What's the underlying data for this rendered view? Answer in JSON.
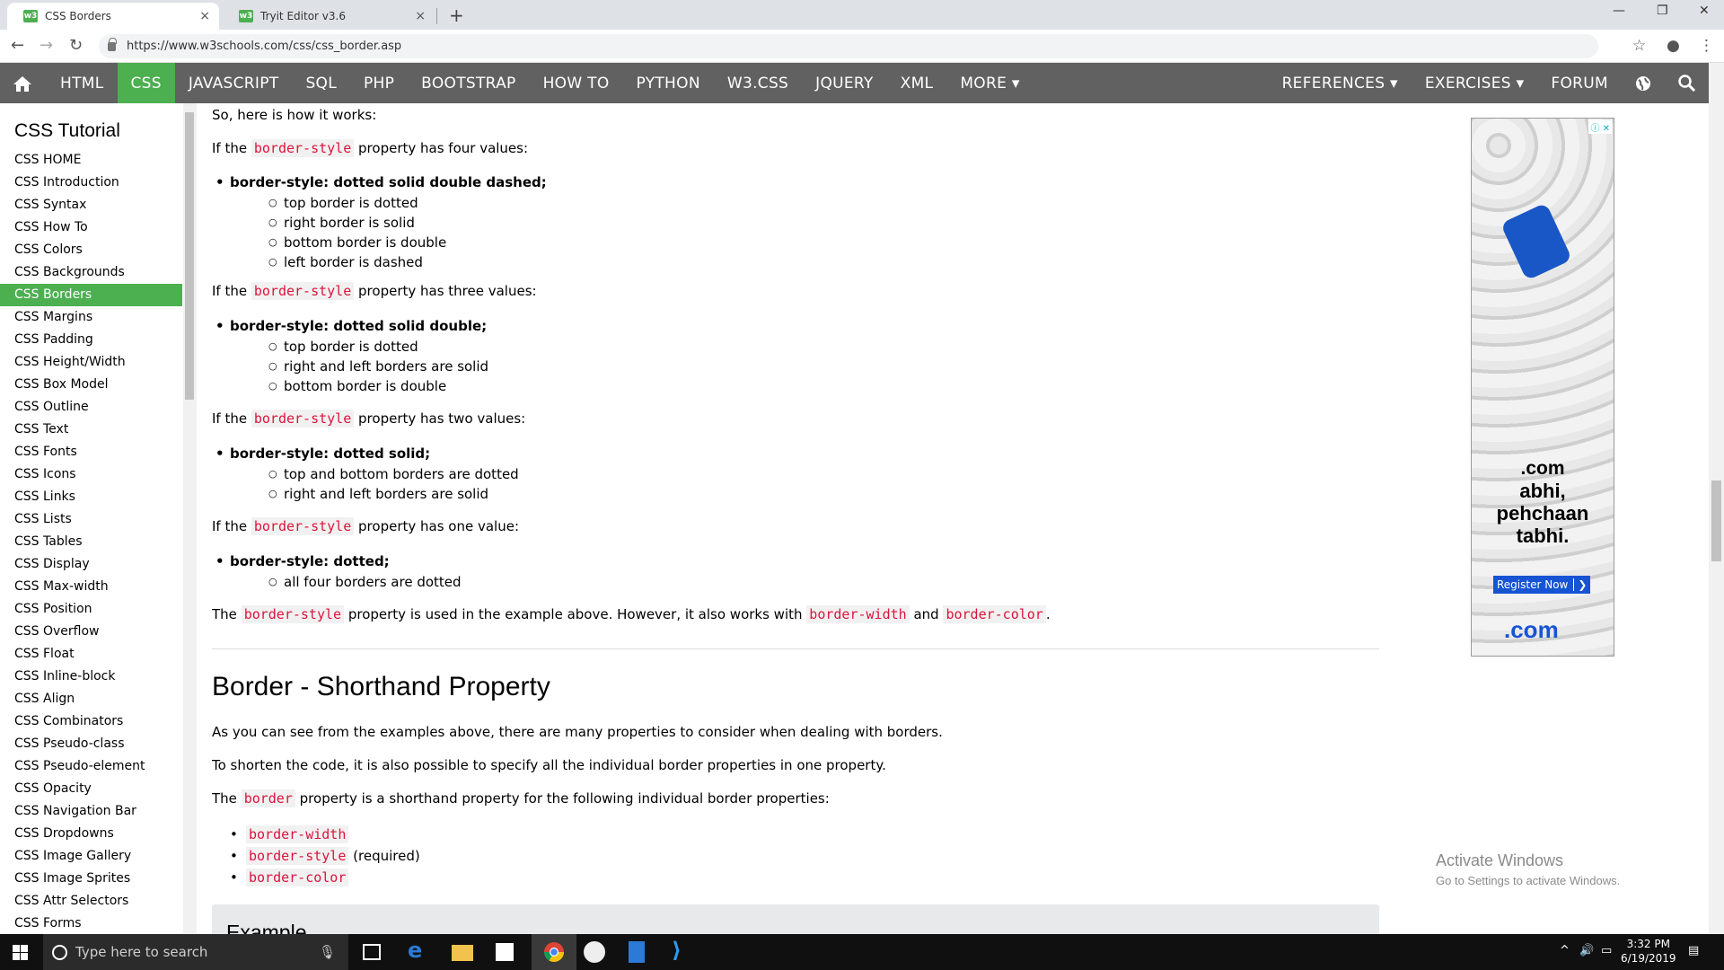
{
  "browser": {
    "tabs": [
      {
        "title": "CSS Borders",
        "close": "×"
      },
      {
        "title": "Tryit Editor v3.6",
        "close": "×"
      }
    ],
    "new_tab": "+",
    "url": "https://www.w3schools.com/css/css_border.asp",
    "window_controls": {
      "minimize": "—",
      "maximize": "❐",
      "close": "✕"
    }
  },
  "topnav": {
    "items": [
      "HTML",
      "CSS",
      "JAVASCRIPT",
      "SQL",
      "PHP",
      "BOOTSTRAP",
      "HOW TO",
      "PYTHON",
      "W3.CSS",
      "JQUERY",
      "XML",
      "MORE ▾"
    ],
    "active": "CSS",
    "right_items": [
      "REFERENCES ▾",
      "EXERCISES ▾",
      "FORUM"
    ]
  },
  "sidebar": {
    "title": "CSS Tutorial",
    "links": [
      "CSS HOME",
      "CSS Introduction",
      "CSS Syntax",
      "CSS How To",
      "CSS Colors",
      "CSS Backgrounds",
      "CSS Borders",
      "CSS Margins",
      "CSS Padding",
      "CSS Height/Width",
      "CSS Box Model",
      "CSS Outline",
      "CSS Text",
      "CSS Fonts",
      "CSS Icons",
      "CSS Links",
      "CSS Lists",
      "CSS Tables",
      "CSS Display",
      "CSS Max-width",
      "CSS Position",
      "CSS Overflow",
      "CSS Float",
      "CSS Inline-block",
      "CSS Align",
      "CSS Combinators",
      "CSS Pseudo-class",
      "CSS Pseudo-element",
      "CSS Opacity",
      "CSS Navigation Bar",
      "CSS Dropdowns",
      "CSS Image Gallery",
      "CSS Image Sprites",
      "CSS Attr Selectors",
      "CSS Forms"
    ],
    "active": "CSS Borders"
  },
  "main": {
    "intro": "So, here is how it works:",
    "if_the": "If the",
    "prop": "border-style",
    "four_suffix": "property has four values:",
    "four_bullet": "border-style: dotted solid double dashed;",
    "four_subs": [
      "top border is dotted",
      "right border is solid",
      "bottom border is double",
      "left border is dashed"
    ],
    "three_suffix": "property has three values:",
    "three_bullet": "border-style: dotted solid double;",
    "three_subs": [
      "top border is dotted",
      "right and left borders are solid",
      "bottom border is double"
    ],
    "two_suffix": "property has two values:",
    "two_bullet": "border-style: dotted solid;",
    "two_subs": [
      "top and bottom borders are dotted",
      "right and left borders are solid"
    ],
    "one_suffix": "property has one value:",
    "one_bullet": "border-style: dotted;",
    "one_subs": [
      "all four borders are dotted"
    ],
    "summary_the": "The",
    "summary_mid": "property is used in the example above. However, it also works with",
    "summary_width": "border-width",
    "summary_and": "and",
    "summary_color": "border-color",
    "summary_end": ".",
    "heading": "Border - Shorthand Property",
    "para1": "As you can see from the examples above, there are many properties to consider when dealing with borders.",
    "para2": "To shorten the code, it is also possible to specify all the individual border properties in one property.",
    "para3_the": "The",
    "para3_code": "border",
    "para3_rest": "property is a shorthand property for the following individual border properties:",
    "short_list": [
      {
        "code": "border-width",
        "note": ""
      },
      {
        "code": "border-style",
        "note": "(required)"
      },
      {
        "code": "border-color",
        "note": ""
      }
    ],
    "example_title": "Example"
  },
  "ad": {
    "badge": "ⓘ ✕",
    "big_text": "com",
    "tagline": [
      ".com",
      "abhi,",
      "pehchaan",
      "tabhi."
    ],
    "button": "Register Now",
    "button_arrow": "❯",
    "footer": ".com"
  },
  "watermark": {
    "title": "Activate Windows",
    "subtitle": "Go to Settings to activate Windows."
  },
  "taskbar": {
    "search_placeholder": "Type here to search",
    "time": "3:32 PM",
    "date": "6/19/2019"
  }
}
